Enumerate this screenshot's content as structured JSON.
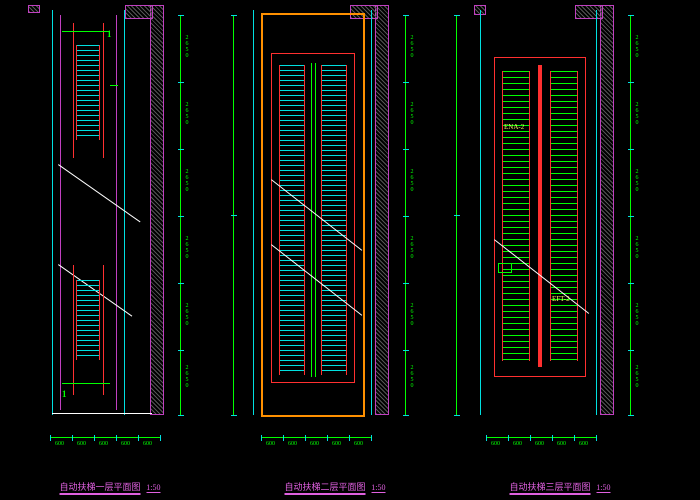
{
  "scale_label": "1:50",
  "plans": [
    {
      "id": "floor1",
      "title": "自动扶梯一层平面图",
      "section_marks": [
        "1",
        "1"
      ],
      "escalator_label": "",
      "dim_bottom": [
        "600",
        "600",
        "600",
        "600",
        "600"
      ],
      "dim_right": [
        "2650",
        "2650",
        "2650",
        "2650",
        "2650",
        "2650"
      ]
    },
    {
      "id": "floor2",
      "title": "自动扶梯二层平面图",
      "section_marks": [],
      "escalator_label": "",
      "dim_bottom": [
        "600",
        "600",
        "600",
        "600",
        "600"
      ],
      "dim_right": [
        "2650",
        "2650",
        "2650",
        "2650",
        "2650",
        "2650"
      ]
    },
    {
      "id": "floor3",
      "title": "自动扶梯三层平面图",
      "section_marks": [],
      "escalator_label_a": "ENA-2",
      "escalator_label_b": "EFT-2",
      "dim_bottom": [
        "600",
        "600",
        "600",
        "600",
        "600"
      ],
      "dim_right": [
        "2650",
        "2650",
        "2650",
        "2650",
        "2650",
        "2650"
      ]
    }
  ]
}
